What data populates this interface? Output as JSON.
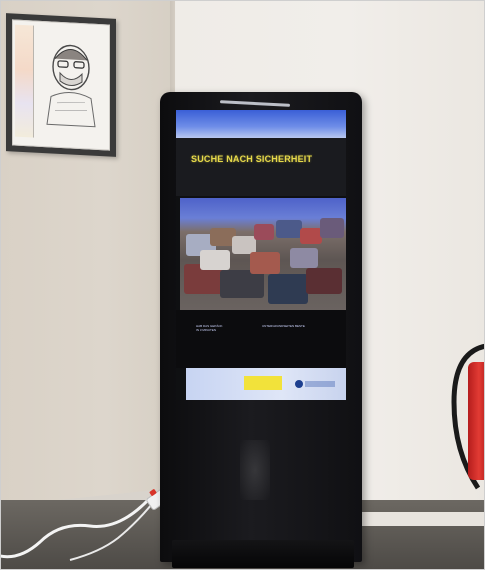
{
  "scene": {
    "subject": "kiosk-display",
    "kiosk_color": "#141417"
  },
  "screen": {
    "headline": "SUCHE NACH SICHERHEIT",
    "headline_color": "#e6d94a",
    "top_bar_color": "#4a6bde",
    "caption_left": [
      "HAB DAS GEPÄCK",
      "IN 3 MINUTEN"
    ],
    "caption_right": [
      "UNTERGRUNDSEITEN BESTE"
    ],
    "footer_color": "#d2dcf4",
    "footer_logo_yellow_color": "#f2e23a",
    "footer_logo_blue_color": "#1d3f8f"
  },
  "wall_art": {
    "icon": "portrait-drawing"
  },
  "objects": {
    "power_strip_switch_color": "#d8342a",
    "extinguisher_color": "#d12b25"
  }
}
